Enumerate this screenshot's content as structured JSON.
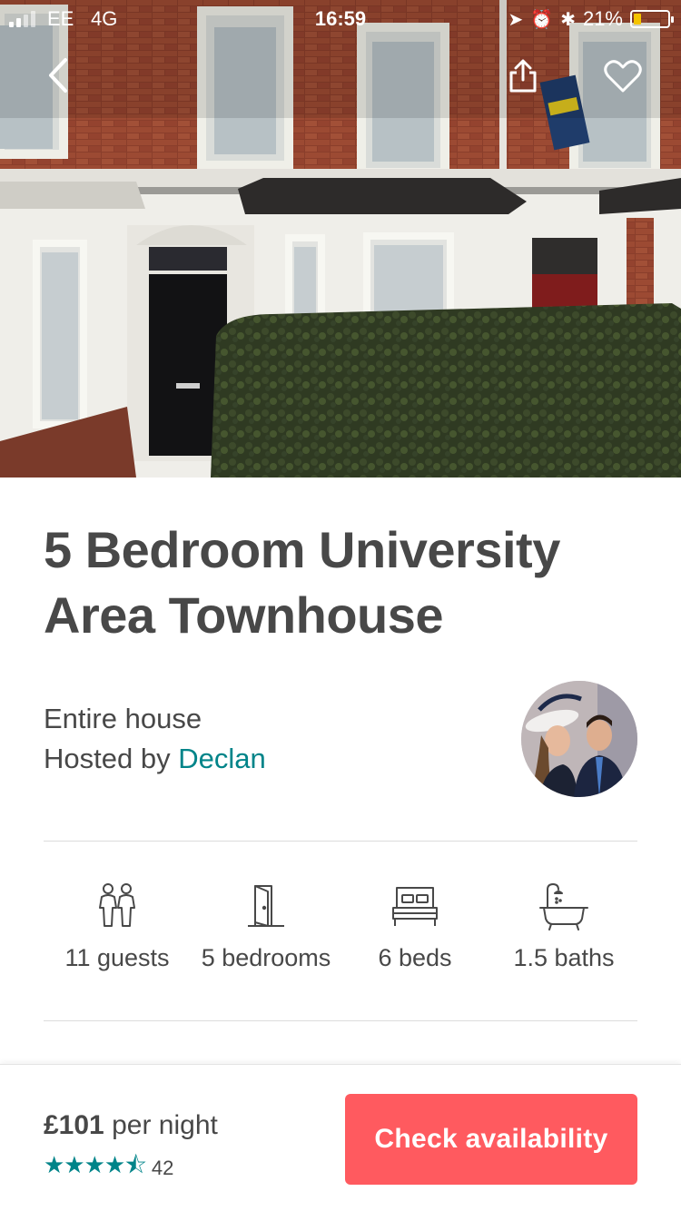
{
  "status_bar": {
    "carrier": "EE",
    "network": "4G",
    "time": "16:59",
    "battery": "21%",
    "battery_level": 0.21
  },
  "header": {
    "back_icon": "chevron-left-icon",
    "share_icon": "share-icon",
    "favorite_icon": "heart-icon"
  },
  "listing": {
    "title": "5 Bedroom University Area Townhouse",
    "room_type": "Entire house",
    "hosted_by_prefix": "Hosted by ",
    "host_name": "Declan",
    "amenities": [
      {
        "icon": "guests-icon",
        "label": "11 guests"
      },
      {
        "icon": "door-icon",
        "label": "5 bedrooms"
      },
      {
        "icon": "bed-icon",
        "label": "6 beds"
      },
      {
        "icon": "bath-icon",
        "label": "1.5 baths"
      }
    ]
  },
  "booking": {
    "price": "£101",
    "price_suffix": " per night",
    "stars": "★★★★⯪",
    "rating_value": 4.5,
    "review_count": "42",
    "cta_label": "Check availability"
  },
  "colors": {
    "accent": "#008489",
    "cta": "#FF5A5F",
    "text": "#484848",
    "battery": "#F5C400"
  }
}
